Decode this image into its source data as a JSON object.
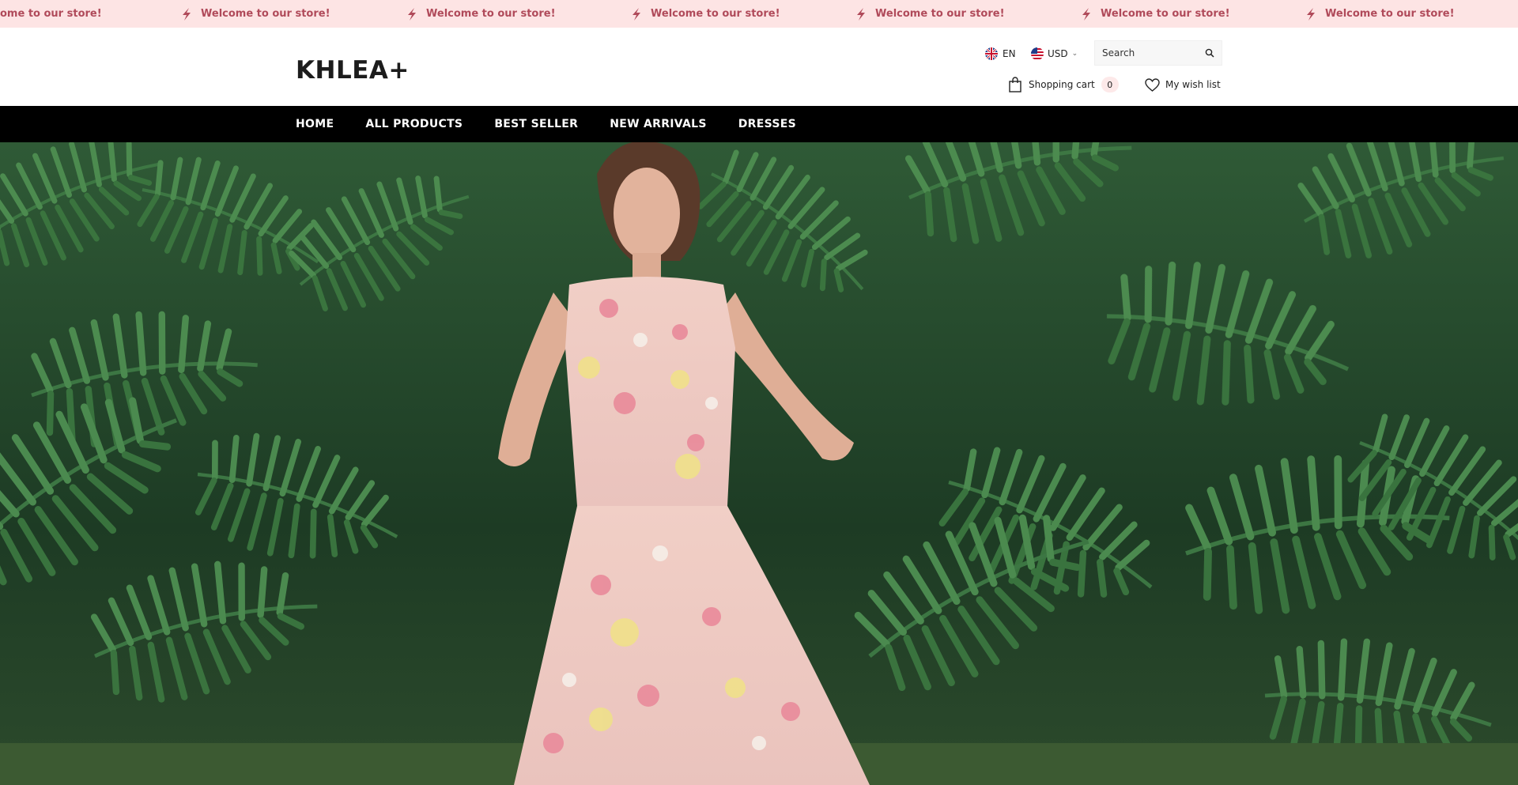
{
  "announcement": {
    "messages": [
      "ome to our store!",
      "Welcome to our store!",
      "Welcome to our store!",
      "Welcome to our store!",
      "Welcome to our store!",
      "Welcome to our store!",
      "Welcome to our store!"
    ],
    "icon": "lightning-bolt-icon",
    "text_color": "#b04a5a",
    "background": "#fde4e4"
  },
  "header": {
    "logo": "KHLEA+",
    "language": {
      "label": "EN",
      "icon": "uk-flag-icon"
    },
    "currency": {
      "label": "USD",
      "icon": "us-flag-icon"
    },
    "search": {
      "placeholder": "Search",
      "value": ""
    },
    "cart": {
      "label": "Shopping cart",
      "count": "0",
      "icon": "shopping-bag-icon"
    },
    "wishlist": {
      "label": "My wish list",
      "icon": "heart-icon"
    }
  },
  "nav": {
    "items": [
      "HOME",
      "ALL PRODUCTS",
      "BEST SELLER",
      "NEW ARRIVALS",
      "DRESSES"
    ],
    "background": "#000000"
  },
  "hero": {
    "image": "model-in-floral-pink-dress-among-palm-leaves"
  }
}
